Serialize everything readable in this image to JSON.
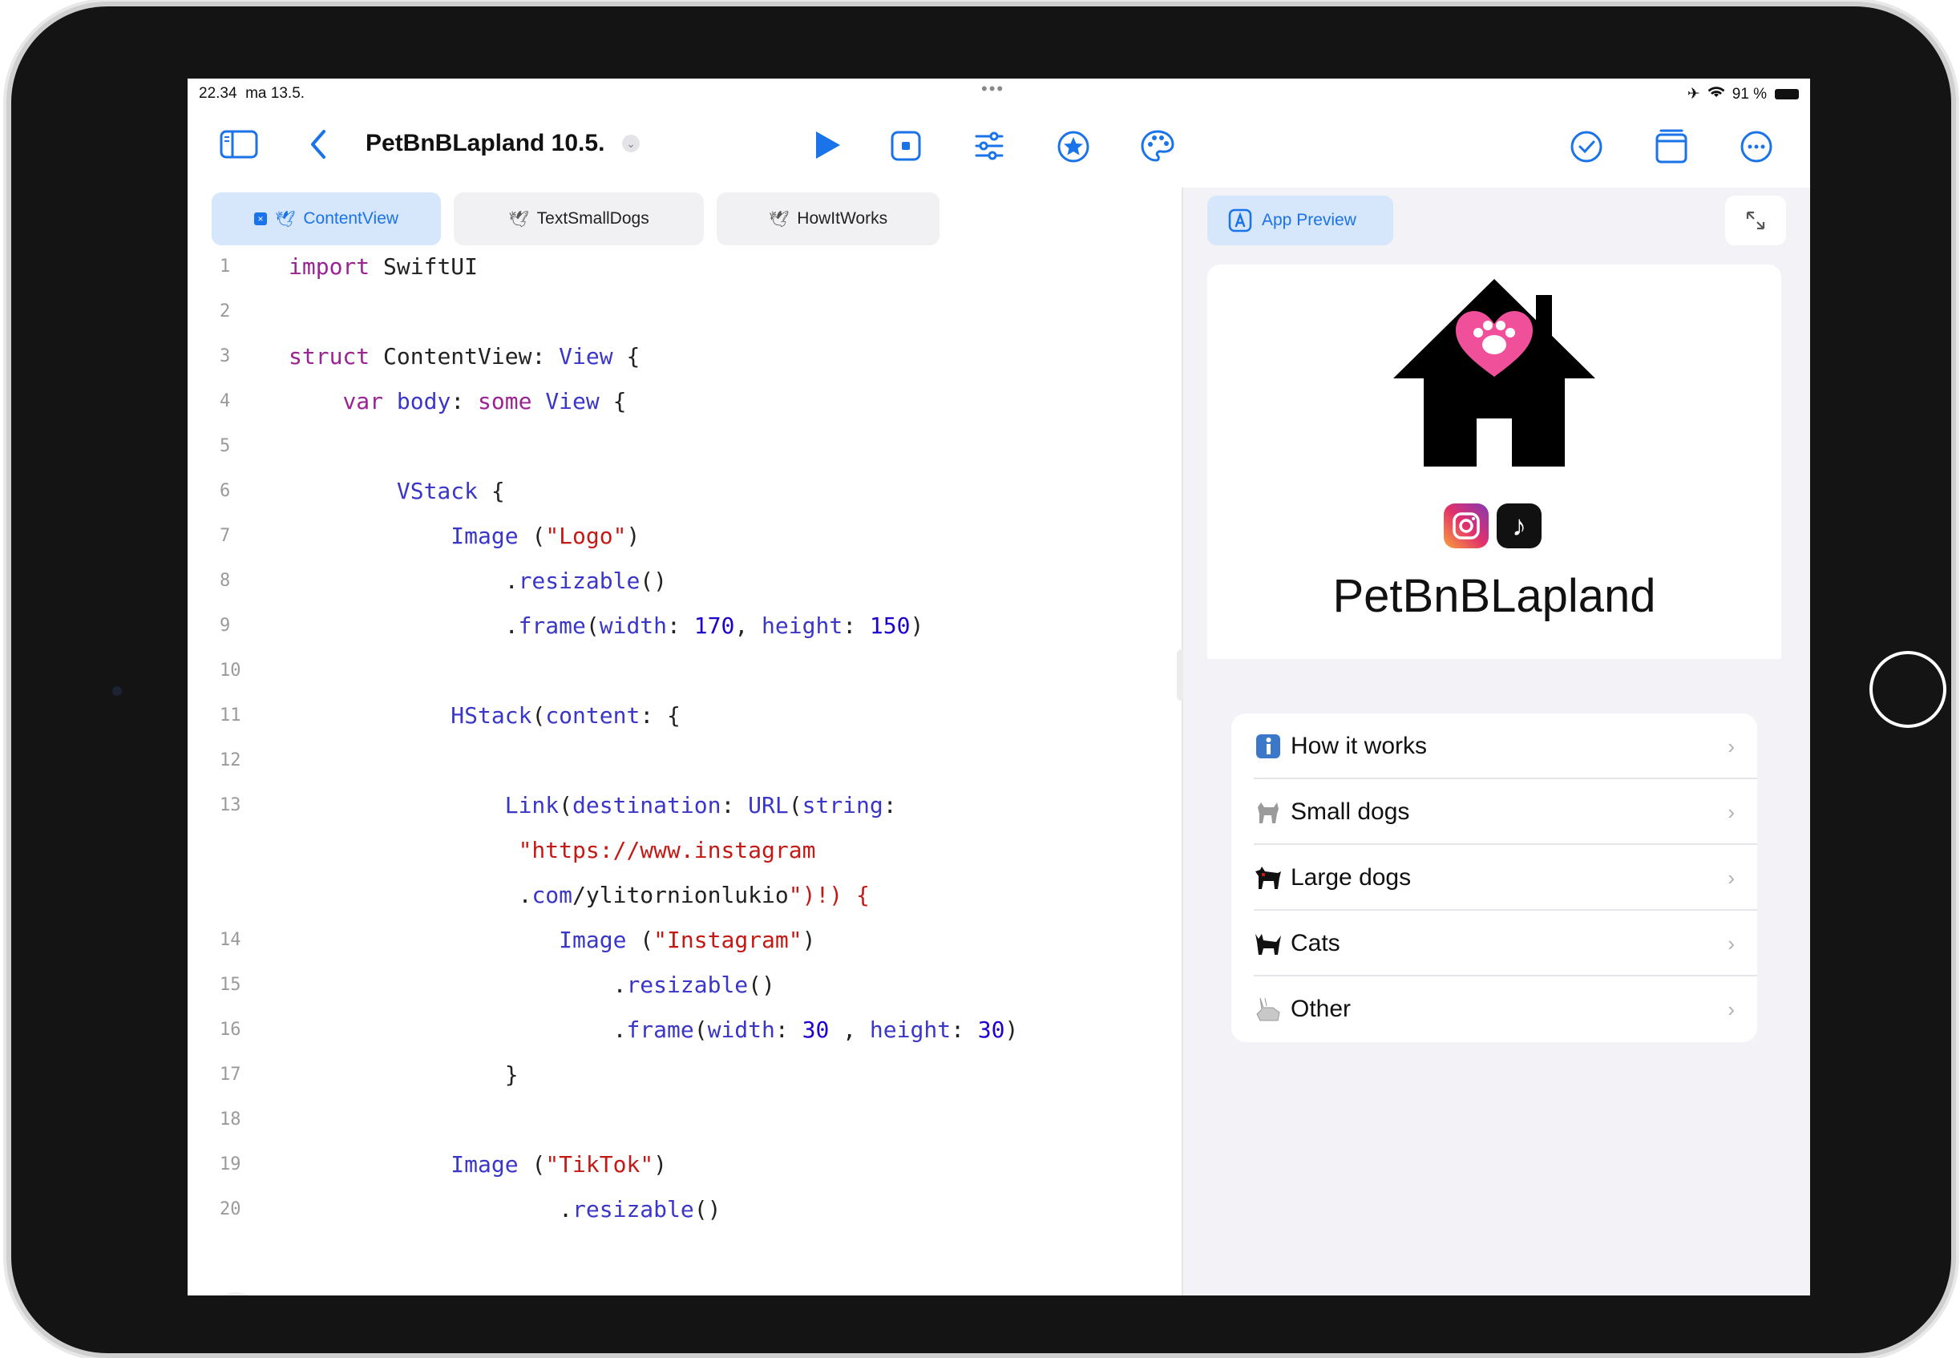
{
  "status_bar": {
    "time": "22.34",
    "date": "ma 13.5.",
    "battery": "91 %"
  },
  "toolbar": {
    "project_title": "PetBnBLapland 10.5."
  },
  "editor": {
    "tabs": [
      {
        "label": "ContentView",
        "active": true
      },
      {
        "label": "TextSmallDogs",
        "active": false
      },
      {
        "label": "HowItWorks",
        "active": false
      }
    ],
    "lines": [
      {
        "n": "1",
        "text": "import SwiftUI"
      },
      {
        "n": "2",
        "text": ""
      },
      {
        "n": "3",
        "text": "struct ContentView: View {"
      },
      {
        "n": "4",
        "text": "    var body: some View {"
      },
      {
        "n": "5",
        "text": ""
      },
      {
        "n": "6",
        "text": "        VStack {"
      },
      {
        "n": "7",
        "text": "            Image (\"Logo\")"
      },
      {
        "n": "8",
        "text": "                .resizable()"
      },
      {
        "n": "9",
        "text": "                .frame(width: 170, height: 150)"
      },
      {
        "n": "10",
        "text": ""
      },
      {
        "n": "11",
        "text": "            HStack(content: {"
      },
      {
        "n": "12",
        "text": ""
      },
      {
        "n": "13",
        "text": "                Link(destination: URL(string:"
      },
      {
        "n": "",
        "text": "                 \"https://www.instagram"
      },
      {
        "n": "",
        "text": "                 .com/ylitornionlukio\")!) {"
      },
      {
        "n": "14",
        "text": "                    Image (\"Instagram\")"
      },
      {
        "n": "15",
        "text": "                        .resizable()"
      },
      {
        "n": "16",
        "text": "                        .frame(width: 30 , height: 30)"
      },
      {
        "n": "17",
        "text": "                }"
      },
      {
        "n": "18",
        "text": ""
      },
      {
        "n": "19",
        "text": "            Image (\"TikTok\")"
      },
      {
        "n": "20",
        "text": "                    .resizable()"
      }
    ]
  },
  "preview": {
    "tab_label": "App Preview",
    "app_title": "PetBnBLapland",
    "menu": [
      {
        "label": "How it works",
        "icon": "info-icon"
      },
      {
        "label": "Small dogs",
        "icon": "small-dog-icon"
      },
      {
        "label": "Large dogs",
        "icon": "large-dog-icon"
      },
      {
        "label": "Cats",
        "icon": "cat-icon"
      },
      {
        "label": "Other",
        "icon": "rabbit-icon"
      }
    ]
  },
  "colors": {
    "accent": "#1a73e8",
    "keyword": "#9b2393",
    "type": "#3a36c8",
    "string": "#c41a16",
    "number": "#1c00cf",
    "logo_heart": "#f0509a"
  }
}
